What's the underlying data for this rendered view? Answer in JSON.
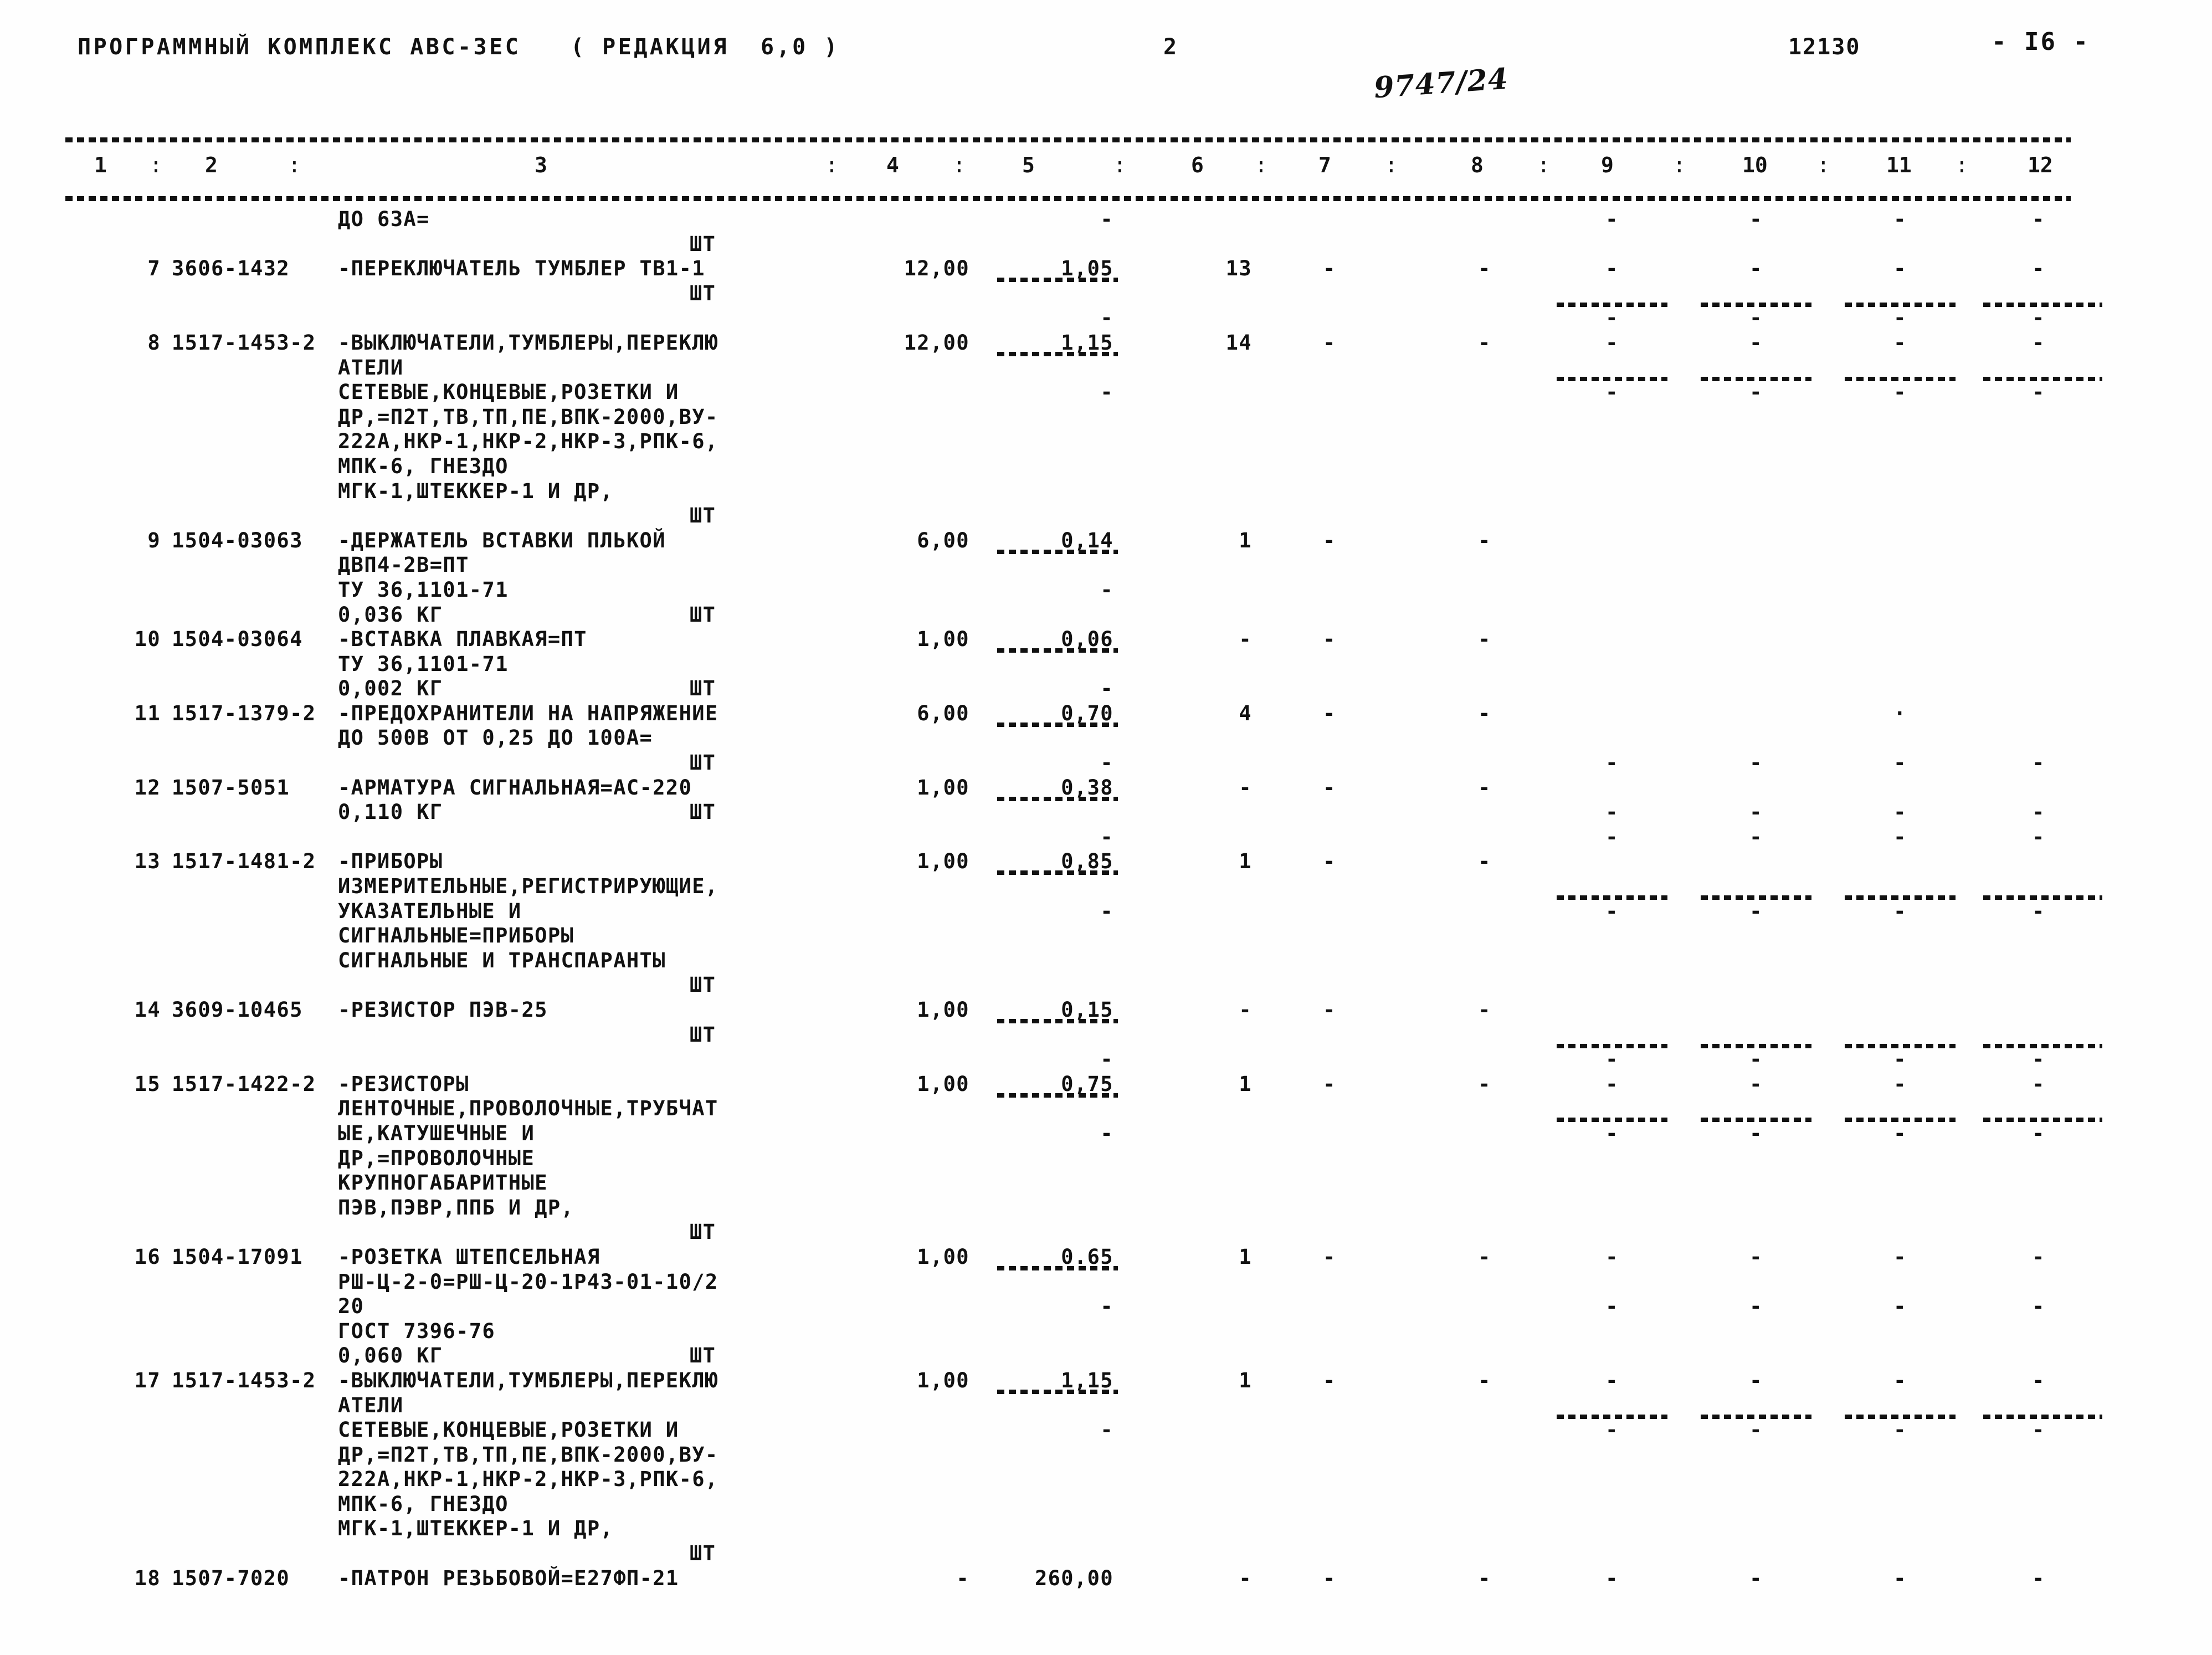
{
  "header": {
    "title": "ПРОГРАММНЫЙ КОМПЛЕКС АВС-3ЕС",
    "edition": "( РЕДАКЦИЯ  6,0 )",
    "page_number": "2",
    "doc_code": "12130",
    "sheet_label": "- I6 -",
    "handwritten_mark": "9747/24"
  },
  "table": {
    "column_headers": [
      "1",
      "2",
      "3",
      "4",
      "5",
      "6",
      "7",
      "8",
      "9",
      "10",
      "11",
      "12"
    ],
    "separator": ":",
    "unit_symbol": "ШТ",
    "dash": "-",
    "lines": [
      {
        "c3": "ДО 63А=",
        "c5": "-",
        "c9": "-",
        "c10": "-",
        "c11": "-",
        "c12": "-"
      },
      {
        "cU": "ШТ"
      },
      {
        "c1": "7",
        "c2": "3606-1432",
        "c3": "-ПЕРЕКЛЮЧАТЕЛЬ ТУМБЛЕР ТВ1-1",
        "c4": "12,00",
        "c5": "1,05",
        "c6": "13",
        "c7": "-",
        "c8": "-",
        "c9": "-",
        "c10": "-",
        "c11": "-",
        "c12": "-",
        "seg5": true
      },
      {
        "cU": "ШТ",
        "seg9": true,
        "seg10": true,
        "seg11": true,
        "seg12": true
      },
      {
        "c5": "-",
        "c9": "-",
        "c10": "-",
        "c11": "-",
        "c12": "-"
      },
      {
        "c1": "8",
        "c2": "1517-1453-2",
        "c3i": "-ВЫКЛЮЧАТЕЛИ,ТУМБЛЕРЫ,ПЕРЕКЛЮ",
        "c4": "12,00",
        "c5": "1,15",
        "c6": "14",
        "c7": "-",
        "c8": "-",
        "c9": "-",
        "c10": "-",
        "c11": "-",
        "c12": "-",
        "seg5": true
      },
      {
        "c3": "АТЕЛИ",
        "seg9": true,
        "seg10": true,
        "seg11": true,
        "seg12": true
      },
      {
        "c3": "СЕТЕВЫЕ,КОНЦЕВЫЕ,РОЗЕТКИ И",
        "c5": "-",
        "c9": "-",
        "c10": "-",
        "c11": "-",
        "c12": "-"
      },
      {
        "c3": "ДР,=П2Т,ТВ,ТП,ПЕ,ВПК-2000,ВУ-"
      },
      {
        "c3": "222А,НКР-1,НКР-2,НКР-3,РПК-6,"
      },
      {
        "c3": "МПК-6, ГНЕЗДО"
      },
      {
        "c3": "МГК-1,ШТЕККЕР-1 И ДР,"
      },
      {
        "cU": "ШТ"
      },
      {
        "c1": "9",
        "c2": "1504-03063",
        "c3": "-ДЕРЖАТЕЛЬ ВСТАВКИ ПЛЬКОЙ",
        "c4": "6,00",
        "c5": "0,14",
        "c6": "1",
        "c7": "-",
        "c8": "-",
        "seg5": true
      },
      {
        "c3": "ДВП4-2В=ПТ"
      },
      {
        "c3": "ТУ 36,1101-71",
        "c5": "-"
      },
      {
        "c3i": "0,036 КГ",
        "cU": "ШТ"
      },
      {
        "c1": "10",
        "c2": "1504-03064",
        "c3": "-ВСТАВКА ПЛАВКАЯ=ПТ",
        "c4": "1,00",
        "c5": "0,06",
        "c6": "-",
        "c7": "-",
        "c8": "-",
        "seg5": true
      },
      {
        "c3": "ТУ 36,1101-71"
      },
      {
        "c3i": "0,002 КГ",
        "c5": "-",
        "cU": "ШТ"
      },
      {
        "c1": "11",
        "c2": "1517-1379-2",
        "c3i": "-ПРЕДОХРАНИТЕЛИ НА НАПРЯЖЕНИЕ",
        "c4": "6,00",
        "c5": "0,70",
        "c6": "4",
        "c7": "-",
        "c8": "-",
        "c11": "·",
        "seg5": true
      },
      {
        "c3": "ДО 500В ОТ 0,25 ДО 100А="
      },
      {
        "cU": "ШТ",
        "c5": "-",
        "c9": "-",
        "c10": "-",
        "c11": "-",
        "c12": "-"
      },
      {
        "c1": "12",
        "c2": "1507-5051",
        "c3": "-АРМАТУРА СИГНАЛЬНАЯ=АС-220",
        "c4": "1,00",
        "c5": "0,38",
        "c6": "-",
        "c7": "-",
        "c8": "-",
        "seg5": true
      },
      {
        "c3i": "0,110 КГ",
        "cU": "ШТ",
        "c9": "-",
        "c10": "-",
        "c11": "-",
        "c12": "-"
      },
      {
        "c5": "-",
        "c9": "-",
        "c10": "-",
        "c11": "-",
        "c12": "-"
      },
      {
        "c1": "13",
        "c2": "1517-1481-2",
        "c3i": "-ПРИБОРЫ",
        "c4": "1,00",
        "c5": "0,85",
        "c6": "1",
        "c7": "-",
        "c8": "-",
        "seg5": true
      },
      {
        "c3": "ИЗМЕРИТЕЛЬНЫЕ,РЕГИСТРИРУЮЩИЕ,",
        "seg9": true,
        "seg10": true,
        "seg11": true,
        "seg12": true
      },
      {
        "c3": "УКАЗАТЕЛЬНЫЕ И",
        "c5": "-",
        "c9": "-",
        "c10": "-",
        "c11": "-",
        "c12": "-"
      },
      {
        "c3": "СИГНАЛЬНЫЕ=ПРИБОРЫ"
      },
      {
        "c3": "СИГНАЛЬНЫЕ И ТРАНСПАРАНТЫ"
      },
      {
        "cU": "ШТ"
      },
      {
        "c1": "14",
        "c2": "3609-10465",
        "c3": "-РЕЗИСТОР ПЭВ-25",
        "c4": "1,00",
        "c5": "0,15",
        "c6": "-",
        "c7": "-",
        "c8": "-",
        "seg5": true
      },
      {
        "cU": "ШТ",
        "seg9": true,
        "seg10": true,
        "seg11": true,
        "seg12": true
      },
      {
        "c5": "-",
        "c9": "-",
        "c10": "-",
        "c11": "-",
        "c12": "-"
      },
      {
        "c1": "15",
        "c2": "1517-1422-2",
        "c3i": "-РЕЗИСТОРЫ",
        "c4": "1,00",
        "c5": "0,75",
        "c6": "1",
        "c7": "-",
        "c8": "-",
        "c9": "-",
        "c10": "-",
        "c11": "-",
        "c12": "-",
        "seg5": true
      },
      {
        "c3": "ЛЕНТОЧНЫЕ,ПРОВОЛОЧНЫЕ,ТРУБЧАТ",
        "seg9": true,
        "seg10": true,
        "seg11": true,
        "seg12": true
      },
      {
        "c3": "ЫЕ,КАТУШЕЧНЫЕ И",
        "c5": "-",
        "c9": "-",
        "c10": "-",
        "c11": "-",
        "c12": "-"
      },
      {
        "c3": "ДР,=ПРОВОЛОЧНЫЕ"
      },
      {
        "c3": "КРУПНОГАБАРИТНЫЕ"
      },
      {
        "c3": "ПЭВ,ПЭВР,ППБ И ДР,"
      },
      {
        "cU": "ШТ"
      },
      {
        "c1": "16",
        "c2": "1504-17091",
        "c3": "-РОЗЕТКА ШТЕПСЕЛЬНАЯ",
        "c4": "1,00",
        "c5": "0.65",
        "c6": "1",
        "c7": "-",
        "c8": "-",
        "c9": "-",
        "c10": "-",
        "c11": "-",
        "c12": "-",
        "seg5": true
      },
      {
        "c3": "РШ-Ц-2-0=РШ-Ц-20-1Р43-01-10/2"
      },
      {
        "c3": "20",
        "c5": "-",
        "c9": "-",
        "c10": "-",
        "c11": "-",
        "c12": "-"
      },
      {
        "c3": "ГОСТ 7396-76"
      },
      {
        "c3i": "0,060 КГ",
        "cU": "ШТ"
      },
      {
        "c1": "17",
        "c2": "1517-1453-2",
        "c3i": "-ВЫКЛЮЧАТЕЛИ,ТУМБЛЕРЫ,ПЕРЕКЛЮ",
        "c4": "1,00",
        "c5": "1,15",
        "c6": "1",
        "c7": "-",
        "c8": "-",
        "c9": "-",
        "c10": "-",
        "c11": "-",
        "c12": "-",
        "seg5": true
      },
      {
        "c3": "АТЕЛИ",
        "seg9": true,
        "seg10": true,
        "seg11": true,
        "seg12": true
      },
      {
        "c3": "СЕТЕВЫЕ,КОНЦЕВЫЕ,РОЗЕТКИ И",
        "c5": "-",
        "c9": "-",
        "c10": "-",
        "c11": "-",
        "c12": "-"
      },
      {
        "c3": "ДР,=П2Т,ТВ,ТП,ПЕ,ВПК-2000,ВУ-"
      },
      {
        "c3": "222А,НКР-1,НКР-2,НКР-3,РПК-6,"
      },
      {
        "c3": "МПК-6, ГНЕЗДО"
      },
      {
        "c3": "МГК-1,ШТЕККЕР-1 И ДР,"
      },
      {
        "cU": "ШТ"
      },
      {
        "c1": "18",
        "c2": "1507-7020",
        "c3": "-ПАТРОН РЕЗЬБОВОЙ=Е27ФП-21",
        "c4": "-",
        "c5": "260,00",
        "c6": "-",
        "c7": "-",
        "c8": "-",
        "c9": "-",
        "c10": "-",
        "c11": "-",
        "c12": "-"
      }
    ]
  }
}
